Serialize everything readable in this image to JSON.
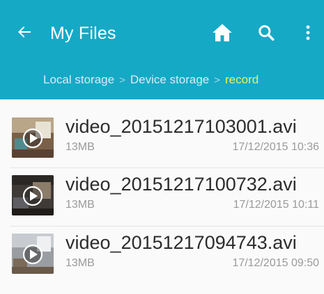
{
  "app": {
    "title": "My Files",
    "accent_color": "#15a9c6",
    "breadcrumb_active_color": "#e8f06a"
  },
  "toolbar": {
    "back_icon": "arrow-left-icon",
    "home_icon": "home-icon",
    "search_icon": "search-icon",
    "more_icon": "more-vertical-icon"
  },
  "breadcrumb": {
    "items": [
      "Local storage",
      "Device storage",
      "record"
    ],
    "separator": ">"
  },
  "files": [
    {
      "name": "video_20151217103001.avi",
      "size": "13MB",
      "date": "17/12/2015 10:36",
      "icon": "video-thumbnail-icon"
    },
    {
      "name": "video_20151217100732.avi",
      "size": "13MB",
      "date": "17/12/2015 10:11",
      "icon": "video-thumbnail-icon"
    },
    {
      "name": "video_20151217094743.avi",
      "size": "13MB",
      "date": "17/12/2015 09:50",
      "icon": "video-thumbnail-icon"
    }
  ]
}
